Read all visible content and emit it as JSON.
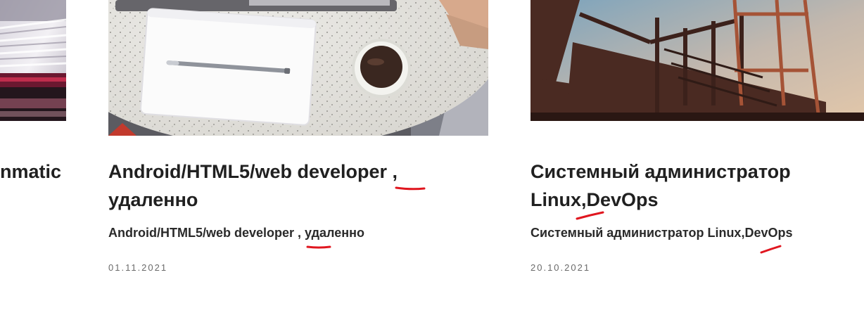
{
  "cards": [
    {
      "title_fragment": "nmatic",
      "image": "train-motion-photo"
    },
    {
      "title_line1": "Android/HTML5/web developer ,",
      "title_line2": "удаленно",
      "subtitle": "Android/HTML5/web developer , удаленно",
      "date": "01.11.2021",
      "image": "desk-notebook-coffee-photo"
    },
    {
      "title_line1": "Системный администратор",
      "title_line2": "Linux,DevOps",
      "subtitle": "Системный администратор Linux,DevOps",
      "date": "20.10.2021",
      "image": "industrial-stairs-photo"
    }
  ],
  "colors": {
    "markup_red": "#e0161f",
    "title_text": "#202020",
    "date_text": "#6a6a6a"
  }
}
